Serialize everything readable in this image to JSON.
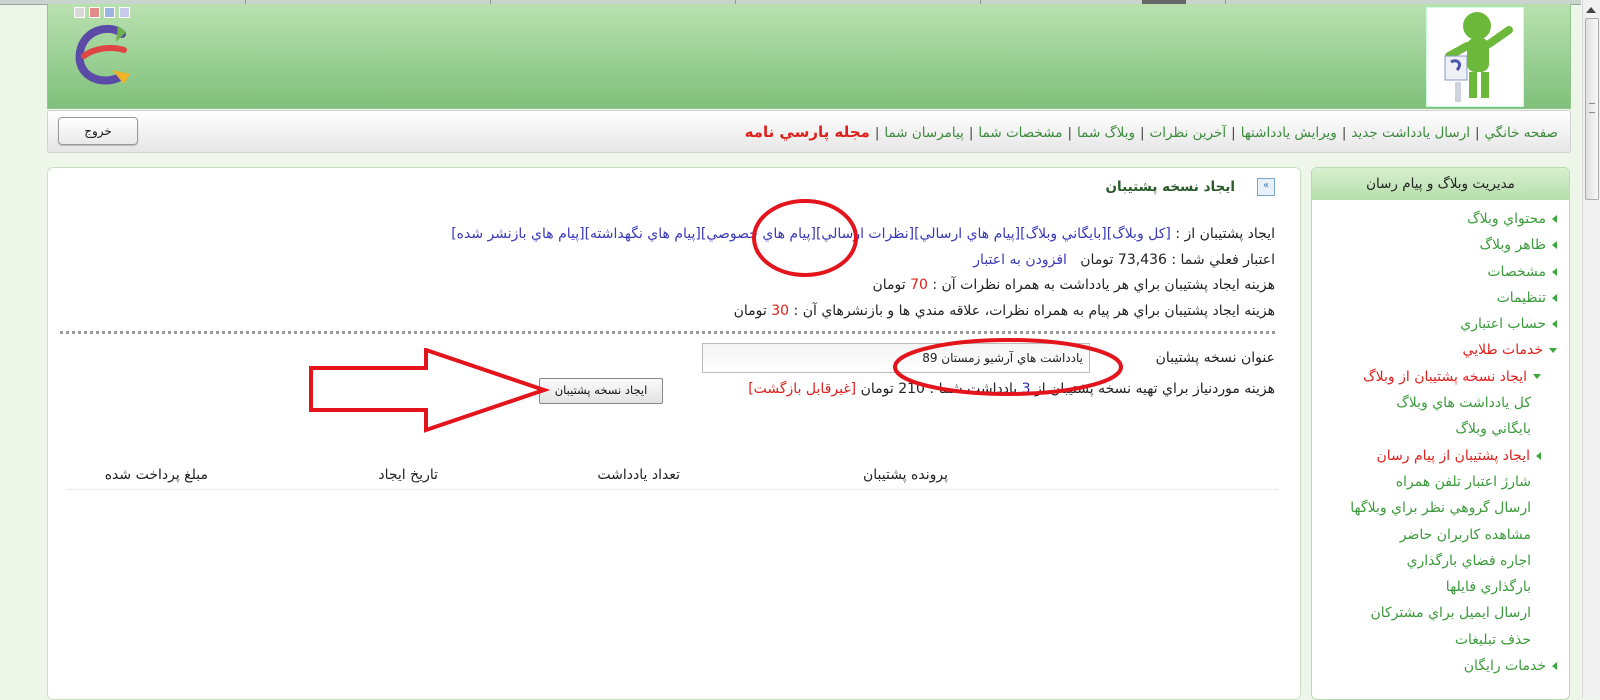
{
  "navbar": {
    "links": [
      "صفحه خانگي",
      "ارسال يادداشت جديد",
      "ويرايش يادداشتها",
      "آخرين نظرات",
      "وبلاگ شما",
      "مشخصات شما",
      "پيامرسان شما"
    ],
    "magazine": "مجله پارسي نامه",
    "logout": "خروج"
  },
  "sidebar": {
    "title": "مديريت وبلاگ و پيام رسان",
    "items": [
      {
        "label": "محتواي وبلاگ"
      },
      {
        "label": "ظاهر وبلاگ"
      },
      {
        "label": "مشخصات"
      },
      {
        "label": "تنظيمات"
      },
      {
        "label": "حساب اعتباري"
      },
      {
        "label": "خدمات طلايي"
      },
      {
        "label": "ايجاد نسخه پشتيبان از وبلاگ"
      },
      {
        "label": "كل يادداشت هاي وبلاگ"
      },
      {
        "label": "بايگاني وبلاگ"
      },
      {
        "label": "ايجاد پشتيبان از پيام رسان"
      },
      {
        "label": "شارژ اعتبار تلفن همراه"
      },
      {
        "label": "ارسال گروهي نظر براي وبلاگها"
      },
      {
        "label": "مشاهده كاربران حاضر"
      },
      {
        "label": "اجاره فضاي بارگذاري"
      },
      {
        "label": "بارگذاري فايلها"
      },
      {
        "label": "ارسال ايميل براي مشتركان"
      },
      {
        "label": "حذف تبليغات"
      },
      {
        "label": "خدمات رايگان"
      }
    ]
  },
  "main": {
    "title": "ايجاد نسخه پشتيبان",
    "backup_from_label": "ايجاد پشتيبان از :",
    "options": [
      "[كل وبلاگ]",
      "[بايگاني وبلاگ]",
      "[پيام هاي ارسالي]",
      "[نظرات ارسالي]",
      "[پيام هاي خصوصي]",
      "[پيام هاي نگهداشته]",
      "[پيام هاي بازنشر شده]"
    ],
    "credit_label": "اعتبار فعلي شما :",
    "credit_value": "73,436",
    "toman": "تومان",
    "add_credit": "افزودن به اعتبار",
    "cost_post_label": "هزينه ايجاد پشتيبان براي هر يادداشت به همراه نظرات آن :",
    "cost_post_value": "70",
    "cost_msg_label": "هزينه ايجاد پشتيبان براي هر پيام به همراه نظرات، علاقه مندي ها و بازنشرهاي آن :",
    "cost_msg_value": "30",
    "backup_title_label": "عنوان نسخه پشتيبان",
    "backup_title_value": "يادداشت هاي آرشيو زمستان 89",
    "required_cost_label_a": "هزينه موردنياز براي تهيه نسخه پشتيبان از",
    "required_count": "3",
    "required_cost_label_b": "يادداشت شما :",
    "required_cost_value": "210",
    "non_refundable": "[غيرقابل بازگشت]",
    "create_button": "ايجاد نسخه پشتيبان",
    "table_headers": [
      "پرونده پشتيبان",
      "تعداد يادداشت",
      "تاريخ ايجاد",
      "مبلغ پرداخت شده"
    ]
  },
  "colors": {
    "accent_green": "#3b9a3b",
    "red": "#e0201b",
    "annotation": "#e3141b"
  }
}
